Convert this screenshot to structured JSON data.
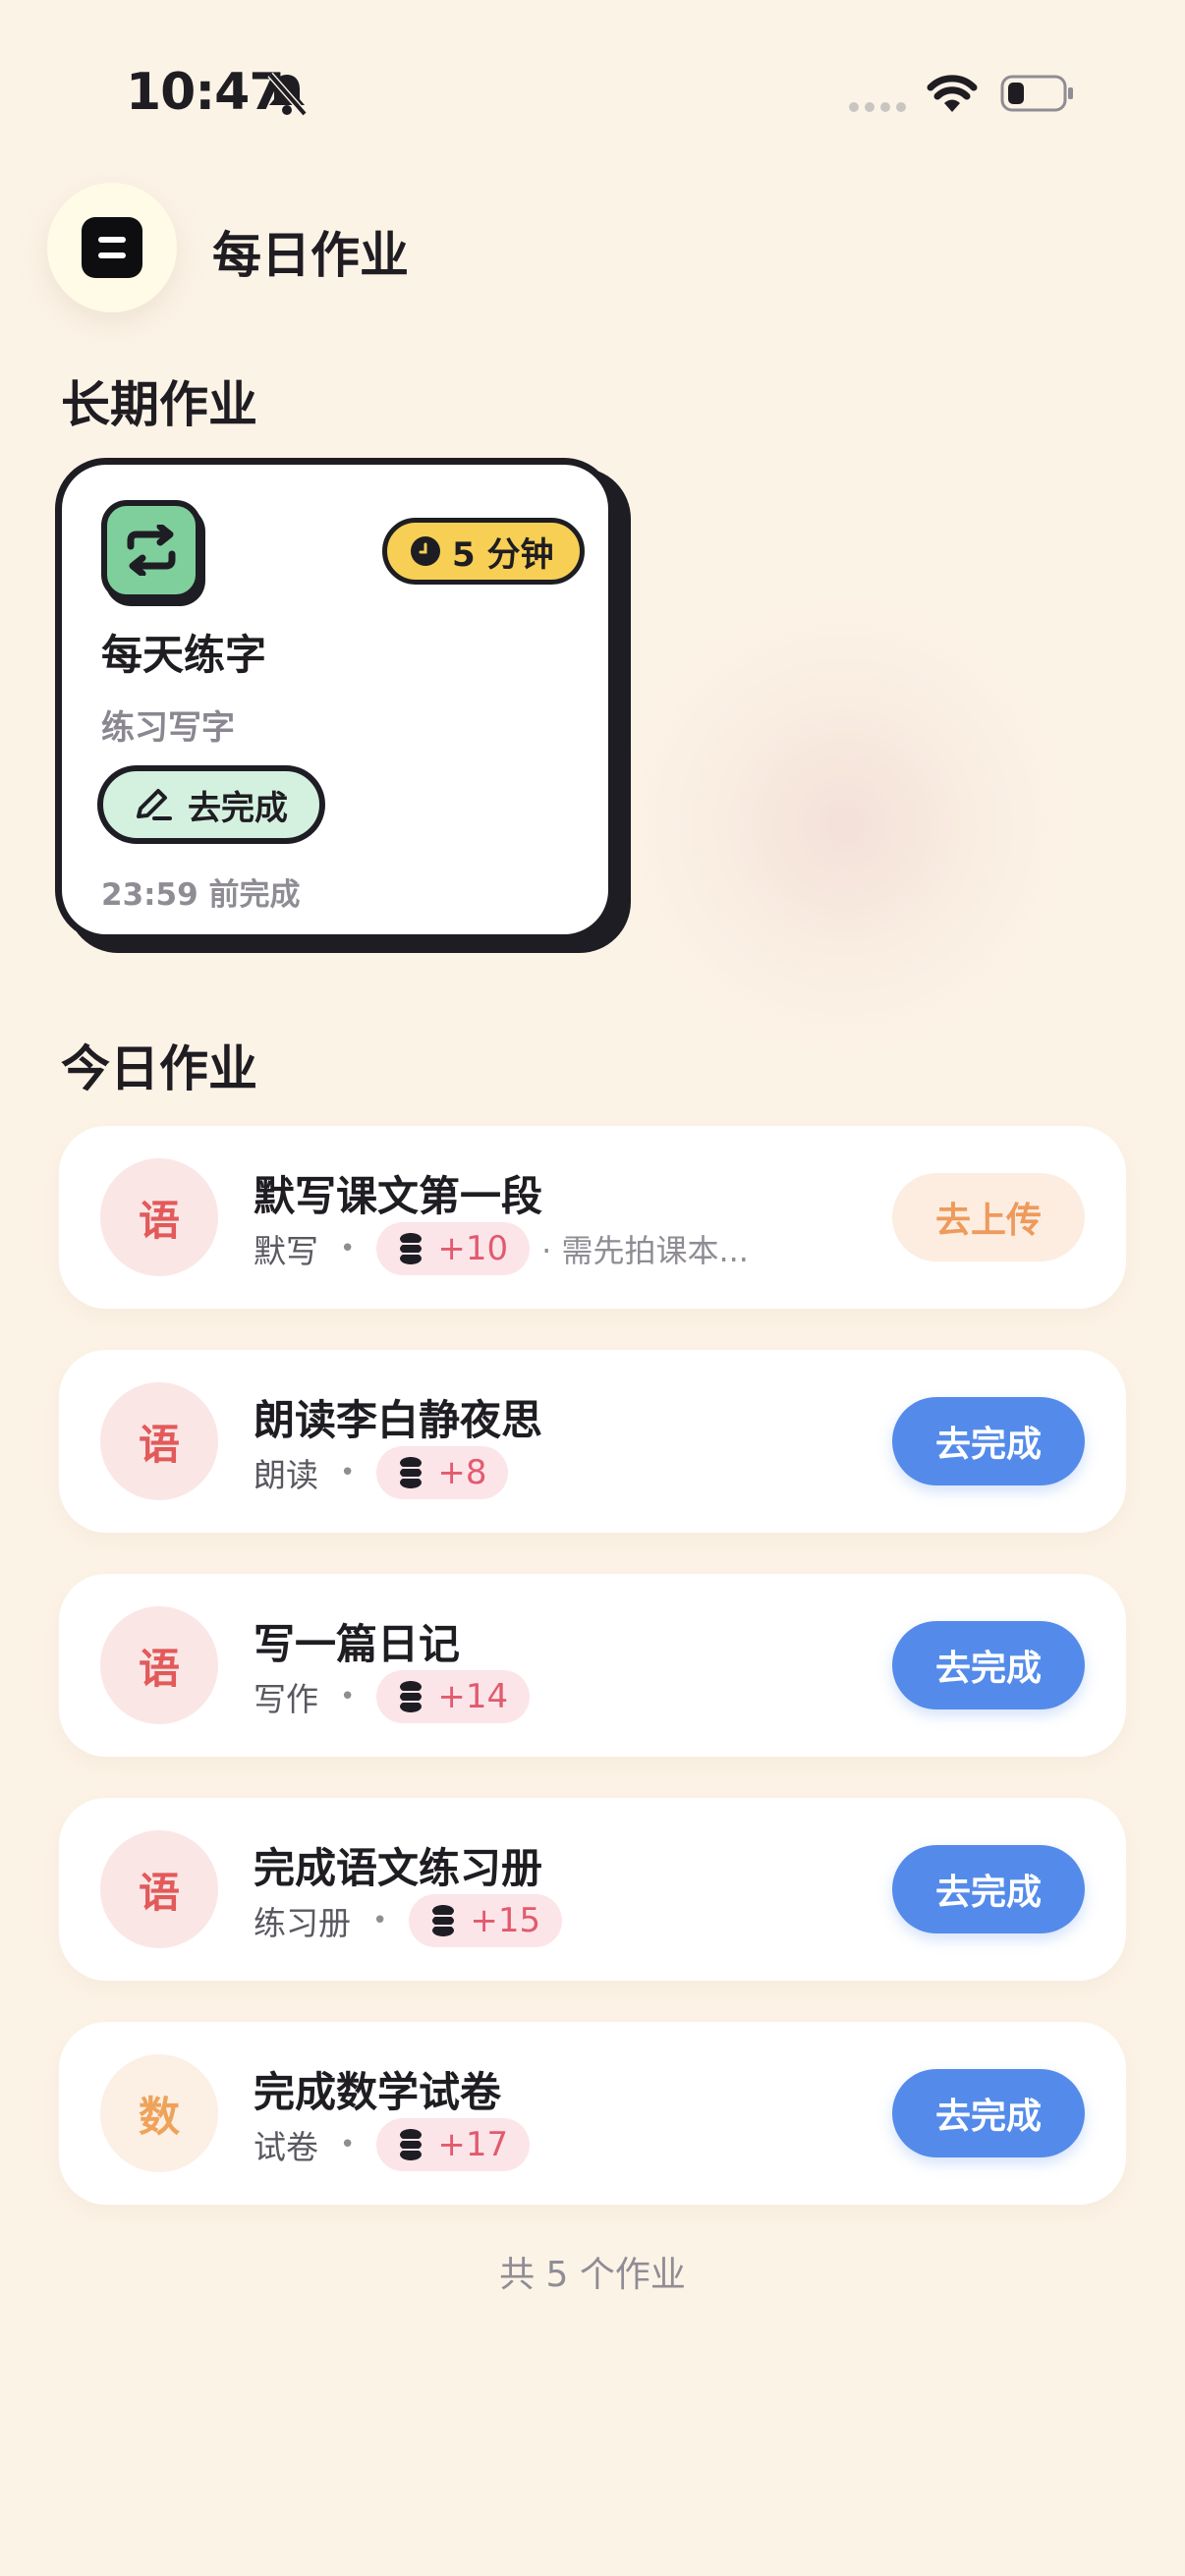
{
  "status_bar": {
    "time": "10:47",
    "icons": [
      "bell-slash-icon",
      "signal-icon",
      "wifi-icon",
      "battery-icon"
    ]
  },
  "header": {
    "title": "每日作业",
    "menu_icon": "menu-icon"
  },
  "long_term": {
    "section_title": "长期作业",
    "card": {
      "icon": "repeat-icon",
      "duration": "5 分钟",
      "title": "每天练字",
      "subtitle": "练习写字",
      "button_label": "去完成",
      "deadline": "23:59 前完成"
    }
  },
  "today": {
    "section_title": "今日作业",
    "tasks": [
      {
        "subject": "语",
        "title": "默写课文第一段",
        "type": "默写",
        "reward": "+10",
        "note": "· 需先拍课本...",
        "button": "去上传"
      },
      {
        "subject": "语",
        "title": "朗读李白静夜思",
        "type": "朗读",
        "reward": "+8",
        "button": "去完成"
      },
      {
        "subject": "语",
        "title": "写一篇日记",
        "type": "写作",
        "reward": "+14",
        "button": "去完成"
      },
      {
        "subject": "语",
        "title": "完成语文练习册",
        "type": "练习册",
        "reward": "+15",
        "button": "去完成"
      },
      {
        "subject": "数",
        "title": "完成数学试卷",
        "type": "试卷",
        "reward": "+17",
        "button": "去完成"
      }
    ],
    "total": "共 5 个作业"
  },
  "colors": {
    "background": "#FCF3E7",
    "primary_button": "#548BEA",
    "upload_button_text": "#EE9A5C",
    "chinese_subject": "#E25A5A",
    "math_subject": "#EFA25A",
    "reward_text": "#E25A6E",
    "duration_pill": "#F6CF54",
    "repeat_tile": "#7FCF9C"
  }
}
